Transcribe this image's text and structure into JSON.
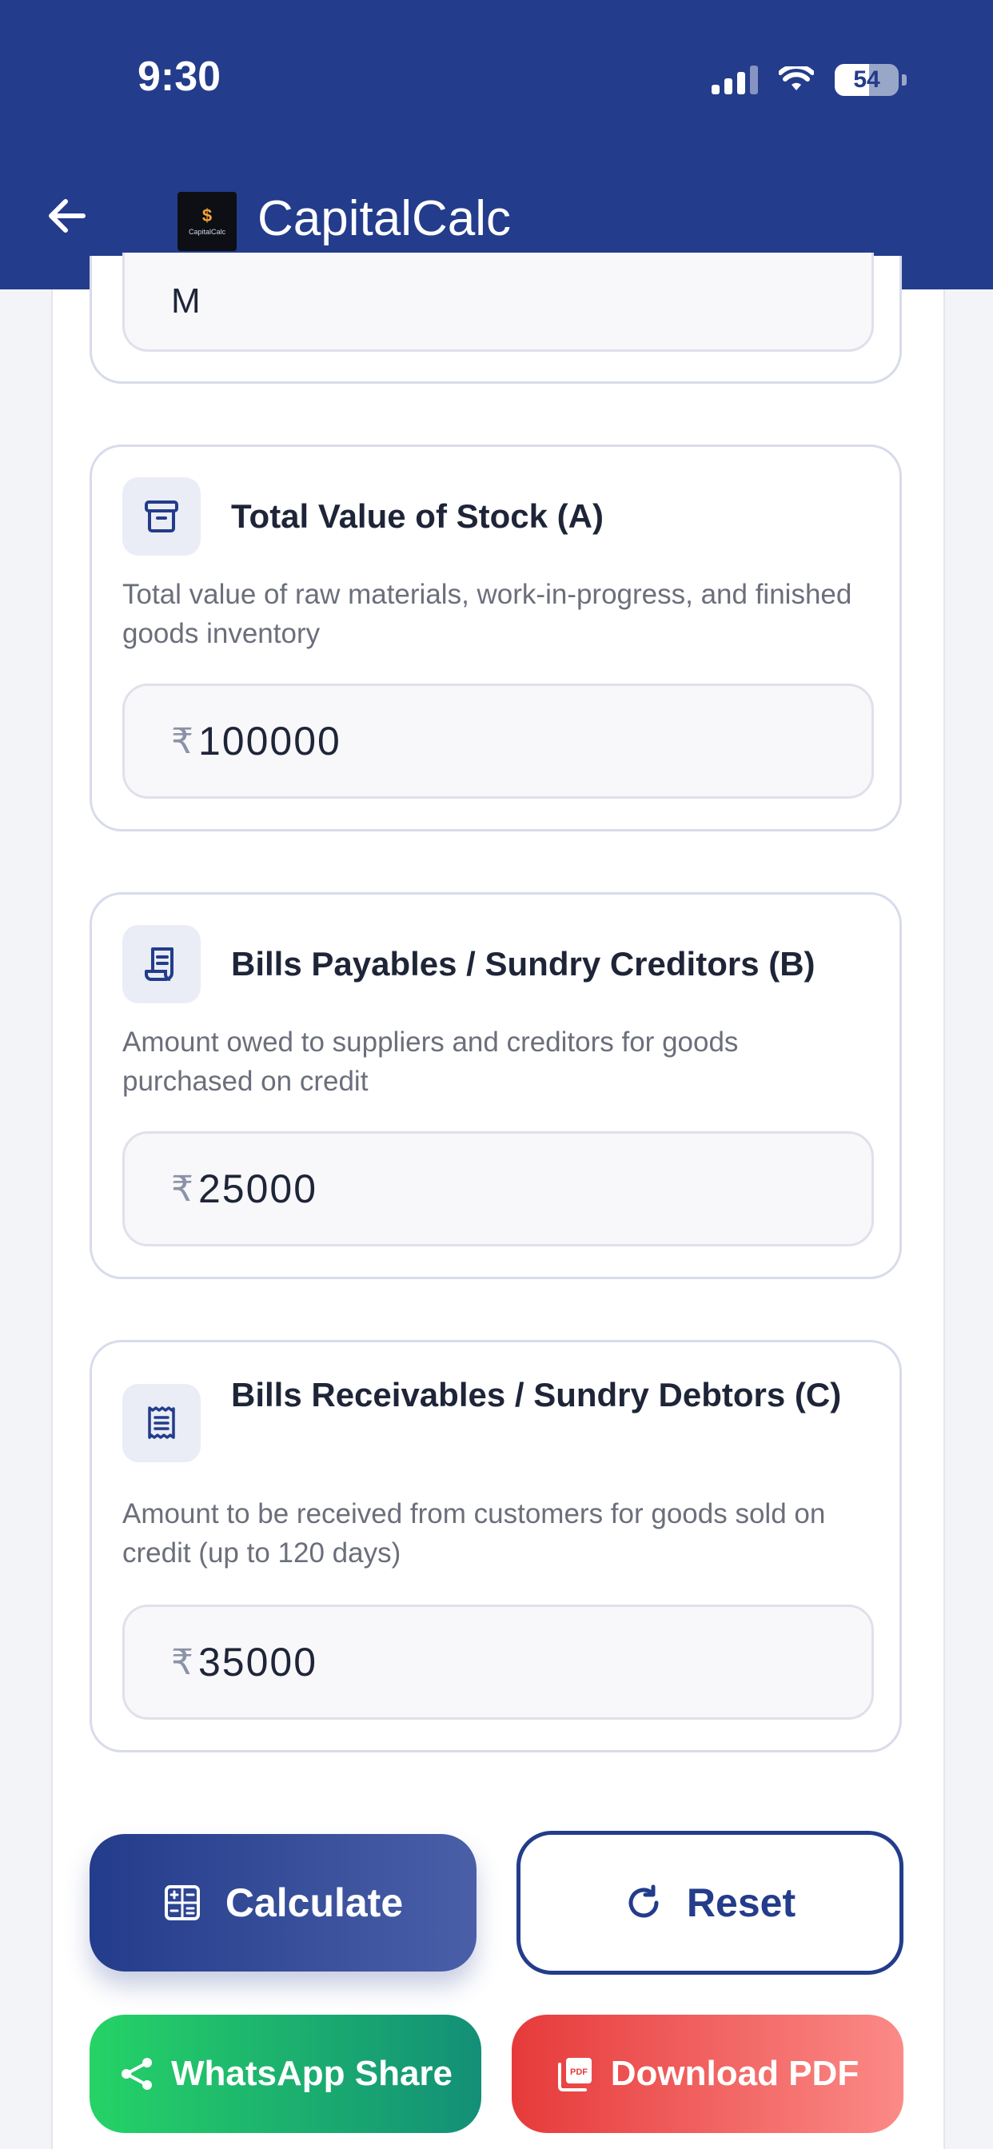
{
  "status": {
    "time": "9:30",
    "battery": "54"
  },
  "header": {
    "title": "CapitalCalc",
    "logo_text": "CapitalCalc"
  },
  "partial_field": {
    "value": "M"
  },
  "fields": [
    {
      "title": "Total Value of Stock (A)",
      "description": "Total value of raw materials, work-in-progress, and finished goods inventory",
      "currency": "₹",
      "value": "100000",
      "icon": "archive-box-icon"
    },
    {
      "title": "Bills Payables / Sundry Creditors (B)",
      "description": "Amount owed to suppliers and creditors for goods purchased on credit",
      "currency": "₹",
      "value": "25000",
      "icon": "document-icon"
    },
    {
      "title": "Bills Receivables / Sundry Debtors (C)",
      "description": "Amount to be received from customers for goods sold on credit (up to 120 days)",
      "currency": "₹",
      "value": "35000",
      "icon": "receipt-icon"
    }
  ],
  "actions": {
    "calculate": "Calculate",
    "reset": "Reset",
    "whatsapp": "WhatsApp Share",
    "download_pdf": "Download PDF"
  },
  "colors": {
    "primary": "#233c8b",
    "whatsapp": "#25d366",
    "pdf": "#e63a3a"
  }
}
